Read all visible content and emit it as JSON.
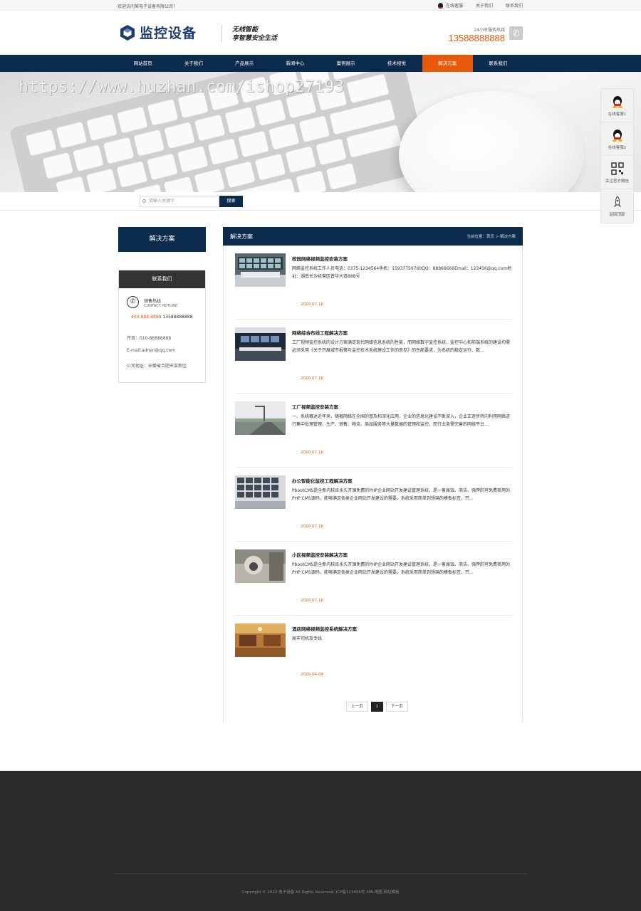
{
  "topbar": {
    "welcome": "欢迎访问某电子设备有限公司！",
    "online": "在线客服",
    "about": "关于我们",
    "contact": "联系我们"
  },
  "header": {
    "logo_text": "监控设备",
    "slogan_line1": "无线智能",
    "slogan_line2": "享智慧安全生活",
    "hotline_label": "24小时服务热线",
    "hotline_number": "13588888888"
  },
  "nav": {
    "items": [
      "网站首页",
      "关于我们",
      "产品展示",
      "新闻中心",
      "案例展示",
      "技术视觉",
      "解决方案",
      "联系我们"
    ],
    "active_index": 6
  },
  "banner": {
    "watermark": "https://www.huzhan.com/ishop27193"
  },
  "search": {
    "placeholder": "请输入关键字",
    "button": "搜索"
  },
  "sidebar": {
    "title": "解决方案",
    "contact_title": "联系我们",
    "hotline_cn": "销售热线",
    "hotline_en": "CONTACT HOTLINE",
    "phone_a": "400-888-8888",
    "phone_b": "13588888888",
    "fax": "传真：010-88888888",
    "email": "E-mail:admin@qq.com",
    "address": "公司地址：安徽省合肥市某新区"
  },
  "float": {
    "qq1": "在线客服1",
    "qq2": "在线客服2",
    "wechat": "关注官方微信",
    "top": "返回顶部"
  },
  "main": {
    "title": "解决方案",
    "breadcrumb": "当前位置：首页 > 解决方案",
    "items": [
      {
        "title": "校园网络视频监控安装方案",
        "desc": "网络监控系统工作人员电话：0375-1234564手机：15937756760QQ：88866666Email：123456@qq.com地址：湖南长沙经营区普华大道888号",
        "date": "2020-07-16"
      },
      {
        "title": "网络综合布线工程解决方案",
        "desc": "工厂视频监控系统的设计方案满足现代网络信息系统的性能，而网络数字监控系统，监控中心和前端系统的建设均需必须采用《关于开展城市报警与监控技术系统建设工作的意见》的性能要求，为系统的稳定运行、数…",
        "date": "2020-07-16"
      },
      {
        "title": "工厂视频监控安装方案",
        "desc": "一、系统概述近年来，随着网络在全国的普及和深化应用，企业的信息化建设不断深入，企业正逐步转向利用网络进行集中处理管理、生产、销售、物流、商品服务等大量数据的管理和监控，而行业急需完善的网络平台…",
        "date": "2020-07-16"
      },
      {
        "title": "办公智能化监控工程解决方案",
        "desc": "PbootCMS是全新内核且永久开源免费的PHP企业网站开发建设管理系统，是一套高效、简洁、强悍的可免费商用的PHP CMS源码，能够满足各类企业网站开发建设的需要。系统采用简单到想哭的模板标签，只…",
        "date": "2020-07-16"
      },
      {
        "title": "小区视频监控安装解决方案",
        "desc": "PbootCMS是全新内核且永久开源免费的PHP企业网站开发建设管理系统，是一套高效、简洁、强悍的可免费商用的PHP CMS源码，能够满足各类企业网站开发建设的需要。系统采用简单到想哭的模板标签，只…",
        "date": "2020-07-16"
      },
      {
        "title": "酒店网络视频监控系统解决方案",
        "desc": "高丰司机及专线",
        "date": "2020-04-04"
      }
    ]
  },
  "pager": {
    "prev": "上一页",
    "current": "1",
    "next": "下一页"
  },
  "footer": {
    "copyright": "Copyright © 2022 电子设备 All Rights Reserved.    ICP备123456号 XML地图 网站模板"
  }
}
